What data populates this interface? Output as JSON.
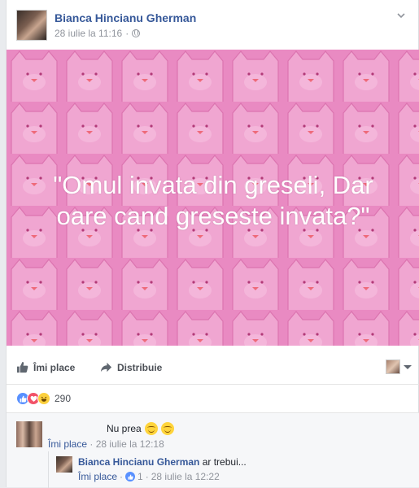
{
  "post": {
    "author": "Bianca Hincianu Gherman",
    "timestamp": "28 iulie la 11:16",
    "separator": "·",
    "quote_line1": "\"Omul invata din greseli, Dar",
    "quote_line2": "oare cand greseste invata?\""
  },
  "actions": {
    "like_label": "Îmi place",
    "share_label": "Distribuie"
  },
  "reactions": {
    "types": [
      "like",
      "love",
      "haha"
    ],
    "count": "290"
  },
  "comments": [
    {
      "text": "Nu prea",
      "like_label": "Îmi place",
      "separator": "·",
      "timestamp": "28 iulie la 12:18"
    },
    {
      "author": "Bianca Hincianu Gherman",
      "text": "ar trebui...",
      "like_label": "Îmi place",
      "separator": "·",
      "likes": "1",
      "separator2": "·",
      "timestamp": "28 iulie la 12:22"
    }
  ],
  "colors": {
    "link": "#365899",
    "pink_bg": "#e88cc3",
    "like_blue": "#5890ff"
  }
}
